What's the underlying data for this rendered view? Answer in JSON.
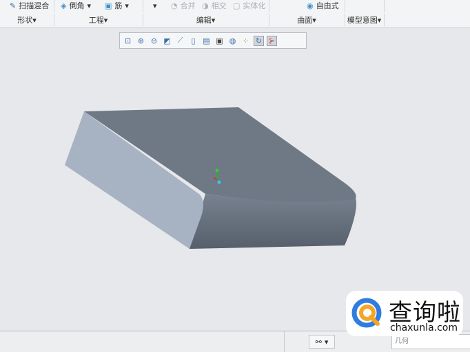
{
  "ribbon": {
    "row1": {
      "sweep_blend": "扫描混合",
      "chamfer": "倒角",
      "rib": "筋",
      "merge": "合并",
      "intersect": "相交",
      "solidify": "实体化",
      "freestyle": "自由式"
    },
    "groups": [
      "形状",
      "工程",
      "编辑",
      "曲面",
      "模型意图"
    ]
  },
  "view_toolbar": {
    "icons": [
      "refit-icon",
      "zoom-in-icon",
      "zoom-out-icon",
      "repaint-icon",
      "display-style-icon",
      "view-orient-icon",
      "saved-views-icon",
      "view-manager-icon",
      "perspective-icon",
      "datum-display-icon",
      "spin-center-icon",
      "annotation-icon"
    ]
  },
  "status_bar": {
    "find_icon": "binoculars-icon",
    "filter_value": "几何"
  },
  "watermark": {
    "brand": "查询啦",
    "url": "chaxunla.com"
  },
  "colors": {
    "top_face": "#6f7986",
    "left_face": "#a7b3c3",
    "front_face": "#5d6673"
  }
}
